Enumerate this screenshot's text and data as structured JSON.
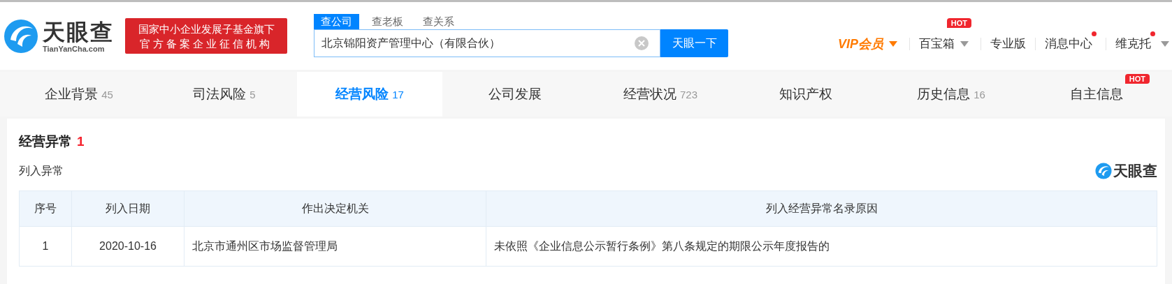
{
  "header": {
    "logo": {
      "name": "天眼查",
      "domain": "TianYanCha.com"
    },
    "badge": [
      "国家中小企业发展子基金旗下",
      "官方备案企业征信机构"
    ],
    "search": {
      "tabs": [
        {
          "label": "查公司",
          "selected": true
        },
        {
          "label": "查老板",
          "selected": false
        },
        {
          "label": "查关系",
          "selected": false
        }
      ],
      "value": "北京锦阳资产管理中心（有限合伙）",
      "button": "天眼一下"
    },
    "nav": [
      {
        "label": "VIP会员",
        "kind": "vip",
        "caret": true,
        "dot": false
      },
      {
        "label": "百宝箱",
        "kind": "plain",
        "caret": true,
        "dot": false,
        "badge": "HOT"
      },
      {
        "label": "专业版",
        "kind": "plain",
        "caret": false,
        "dot": false
      },
      {
        "label": "消息中心",
        "kind": "plain",
        "caret": false,
        "dot": true
      },
      {
        "label": "维克托",
        "kind": "plain",
        "caret": true,
        "dot": true
      }
    ]
  },
  "tabs": [
    {
      "label": "企业背景",
      "count": "45",
      "selected": false
    },
    {
      "label": "司法风险",
      "count": "5",
      "selected": false
    },
    {
      "label": "经营风险",
      "count": "17",
      "selected": true
    },
    {
      "label": "公司发展",
      "selected": false
    },
    {
      "label": "经营状况",
      "count": "723",
      "selected": false
    },
    {
      "label": "知识产权",
      "selected": false
    },
    {
      "label": "历史信息",
      "count": "16",
      "selected": false
    },
    {
      "label": "自主信息",
      "selected": false,
      "badge": "HOT"
    }
  ],
  "section": {
    "title": "经营异常",
    "count": "1",
    "subtitle": "列入异常",
    "logo": "天眼查"
  },
  "table": {
    "columns": [
      "序号",
      "列入日期",
      "作出决定机关",
      "列入经营异常名录原因"
    ],
    "rows": [
      [
        "1",
        "2020-10-16",
        "北京市通州区市场监督管理局",
        "未依照《企业信息公示暂行条例》第八条规定的期限公示年度报告的"
      ]
    ]
  }
}
